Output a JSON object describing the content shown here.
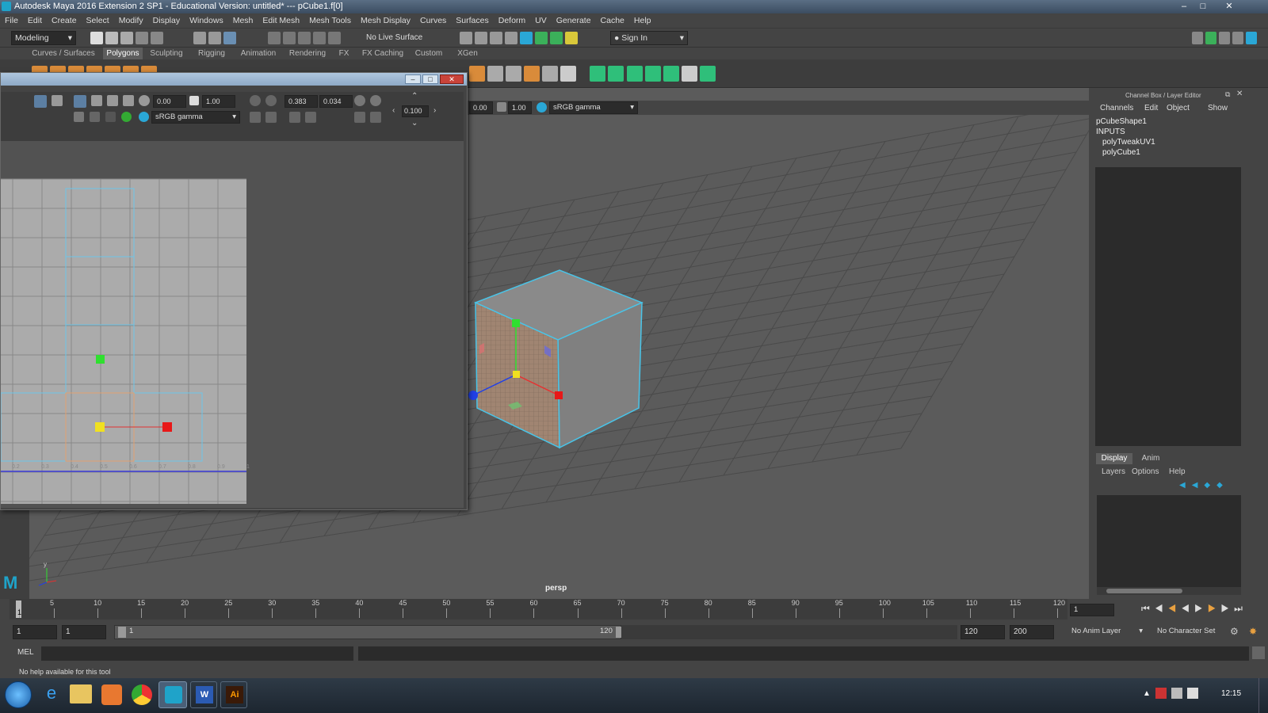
{
  "window": {
    "title": "Autodesk Maya 2016 Extension 2 SP1 - Educational Version: untitled*   ---   pCube1.f[0]"
  },
  "menu": [
    "File",
    "Edit",
    "Create",
    "Select",
    "Modify",
    "Display",
    "Windows",
    "Mesh",
    "Edit Mesh",
    "Mesh Tools",
    "Mesh Display",
    "Curves",
    "Surfaces",
    "Deform",
    "UV",
    "Generate",
    "Cache",
    "Help"
  ],
  "status": {
    "mode": "Modeling",
    "live_surface": "No Live Surface",
    "sign_in": "Sign In"
  },
  "shelf_tabs": [
    {
      "label": "Curves / Surfaces",
      "active": false
    },
    {
      "label": "Polygons",
      "active": true
    },
    {
      "label": "Sculpting",
      "active": false
    },
    {
      "label": "Rigging",
      "active": false
    },
    {
      "label": "Animation",
      "active": false
    },
    {
      "label": "Rendering",
      "active": false
    },
    {
      "label": "FX",
      "active": false
    },
    {
      "label": "FX Caching",
      "active": false
    },
    {
      "label": "Custom",
      "active": false
    },
    {
      "label": "XGen",
      "active": false
    }
  ],
  "viewport": {
    "exposure": "0.00",
    "gamma": "1.00",
    "color_space": "sRGB gamma",
    "camera": "persp"
  },
  "uv_editor": {
    "exposure": "0.00",
    "gamma": "1.00",
    "color_space": "sRGB gamma",
    "u_value": "0.383",
    "v_value": "0.034",
    "step": "0.100",
    "ruler": [
      "0.2",
      "0.3",
      "0.4",
      "0.5",
      "0.6",
      "0.7",
      "0.8",
      "0.9",
      "1"
    ]
  },
  "channel_box": {
    "title": "Channel Box / Layer Editor",
    "menu": [
      "Channels",
      "Edit",
      "Object",
      "Show"
    ],
    "object": "pCubeShape1",
    "inputs_label": "INPUTS",
    "inputs": [
      "polyTweakUV1",
      "polyCube1"
    ],
    "layer_tabs": [
      "Display",
      "Anim"
    ],
    "layer_menu": [
      "Layers",
      "Options",
      "Help"
    ]
  },
  "timeline": {
    "ticks": [
      "1",
      "5",
      "10",
      "15",
      "20",
      "25",
      "30",
      "35",
      "40",
      "45",
      "50",
      "55",
      "60",
      "65",
      "70",
      "75",
      "80",
      "85",
      "90",
      "95",
      "100",
      "105",
      "110",
      "115",
      "120"
    ],
    "current_frame": "1"
  },
  "range": {
    "start": "1",
    "start2": "1",
    "slider_start": "1",
    "slider_end": "120",
    "end": "120",
    "end2": "200",
    "anim_layer": "No Anim Layer",
    "char_set": "No Character Set"
  },
  "cmd": {
    "label": "MEL"
  },
  "help_text": "No help available for this tool",
  "taskbar": {
    "time": "12:15"
  }
}
